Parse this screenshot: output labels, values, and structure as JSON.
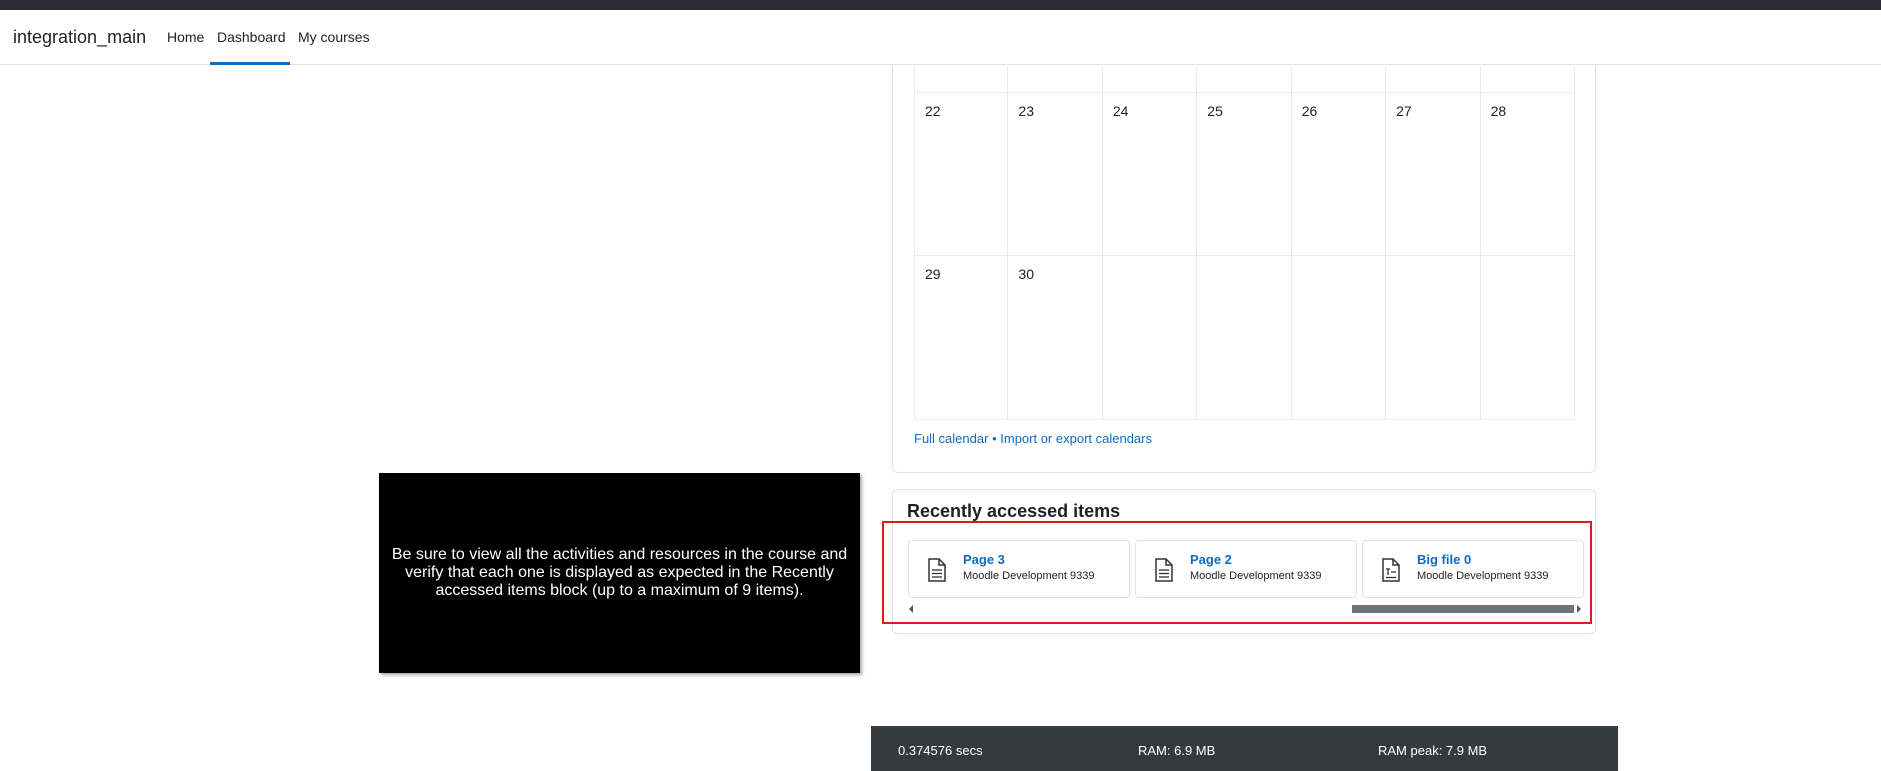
{
  "navbar": {
    "brand": "integration_main",
    "items": [
      {
        "label": "Home",
        "active": false
      },
      {
        "label": "Dashboard",
        "active": true
      },
      {
        "label": "My courses",
        "active": false
      }
    ],
    "accent_color": "#0f6cbf"
  },
  "calendar": {
    "rows": [
      [
        "22",
        "23",
        "24",
        "25",
        "26",
        "27",
        "28"
      ],
      [
        "29",
        "30",
        "",
        "",
        "",
        "",
        ""
      ]
    ],
    "full_calendar_link": "Full calendar",
    "separator": "•",
    "import_export_link": "Import or export calendars"
  },
  "tour_step": {
    "text": "Be sure to view all the activities and resources in the course and verify that each one is displayed as expected in the Recently accessed items block (up to a maximum of 9 items)."
  },
  "recently_accessed": {
    "title": "Recently accessed items",
    "items": [
      {
        "name": "Page 3",
        "course": "Moodle Development 9339",
        "icon": "page-icon"
      },
      {
        "name": "Page 2",
        "course": "Moodle Development 9339",
        "icon": "page-icon"
      },
      {
        "name": "Big file 0",
        "course": "Moodle Development 9339",
        "icon": "file-text-icon"
      }
    ],
    "highlight_color": "#e01b1b"
  },
  "performance": {
    "time": "0.374576 secs",
    "ram": "RAM: 6.9 MB",
    "ram_peak": "RAM peak: 7.9 MB"
  }
}
